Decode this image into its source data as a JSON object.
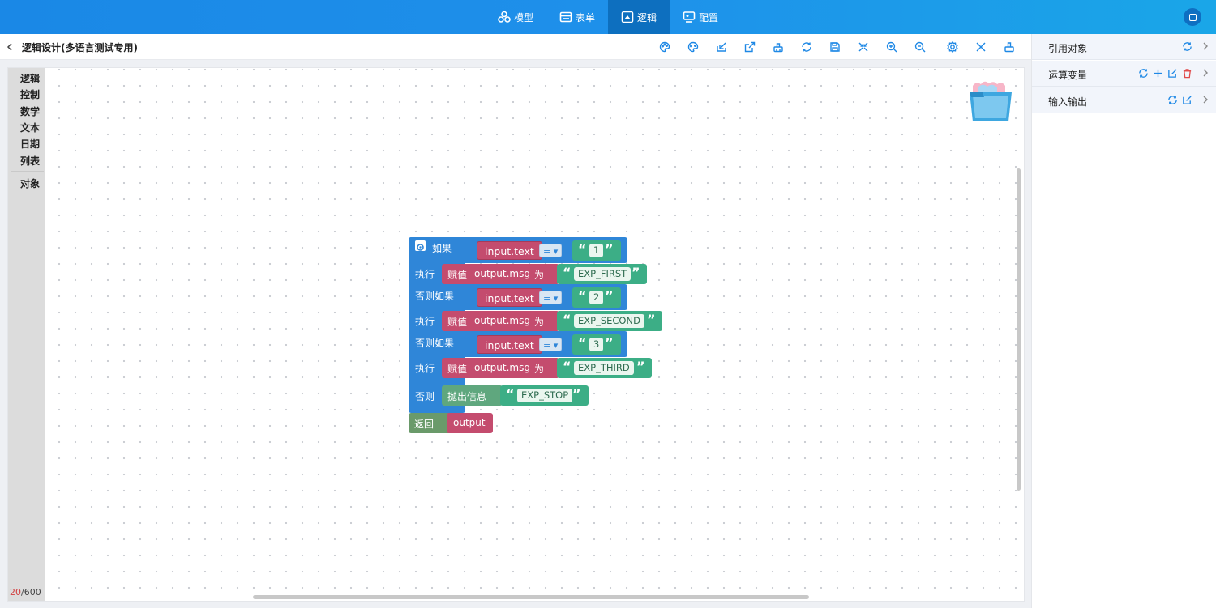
{
  "topnav": {
    "items": [
      {
        "label": "模型",
        "icon": "model-icon",
        "active": false
      },
      {
        "label": "表单",
        "icon": "form-icon",
        "active": false
      },
      {
        "label": "逻辑",
        "icon": "logic-icon",
        "active": true
      },
      {
        "label": "配置",
        "icon": "config-icon",
        "active": false
      }
    ]
  },
  "header": {
    "title": "逻辑设计(多语言测试专用)"
  },
  "toolbar": {
    "tools": [
      "palette-icon",
      "palette-alt-icon",
      "import-icon",
      "export-icon",
      "clean-icon",
      "refresh-icon",
      "save-icon",
      "collapse-icon",
      "zoom-in-icon",
      "zoom-out-icon",
      "settings-icon",
      "close-icon",
      "brush-icon"
    ]
  },
  "categories": {
    "items": [
      "逻辑",
      "控制",
      "数学",
      "文本",
      "日期",
      "列表"
    ],
    "extra": "对象"
  },
  "counter": {
    "used": "20",
    "total": "/600"
  },
  "blocks": {
    "if_label": "如果",
    "do_label": "执行",
    "elseif_label": "否则如果",
    "else_label": "否则",
    "return_label": "返回",
    "var_input": "input.text",
    "op_eq": "= ▾",
    "assign_label": "赋值",
    "var_output_msg": "output.msg",
    "as_label": "为",
    "open_quote": "“",
    "close_quote": "”",
    "val1": "1",
    "val2": "2",
    "val3": "3",
    "exp_first": "EXP_FIRST",
    "exp_second": "EXP_SECOND",
    "exp_third": "EXP_THIRD",
    "throw_label": "抛出信息",
    "exp_stop": "EXP_STOP",
    "var_output": "output"
  },
  "rightpanel": {
    "rows": [
      {
        "label": "引用对象",
        "icons": [
          "refresh-icon"
        ]
      },
      {
        "label": "运算变量",
        "icons": [
          "refresh-icon",
          "plus-icon",
          "edit-icon",
          "delete-icon"
        ]
      },
      {
        "label": "输入输出",
        "icons": [
          "refresh-icon",
          "edit-icon"
        ]
      }
    ]
  },
  "colors": {
    "topbar": "#1a88e6",
    "control_block": "#2f86d8",
    "variable_block": "#c44c6e",
    "text_block": "#3cae86",
    "return_block": "#6a9a6a"
  }
}
